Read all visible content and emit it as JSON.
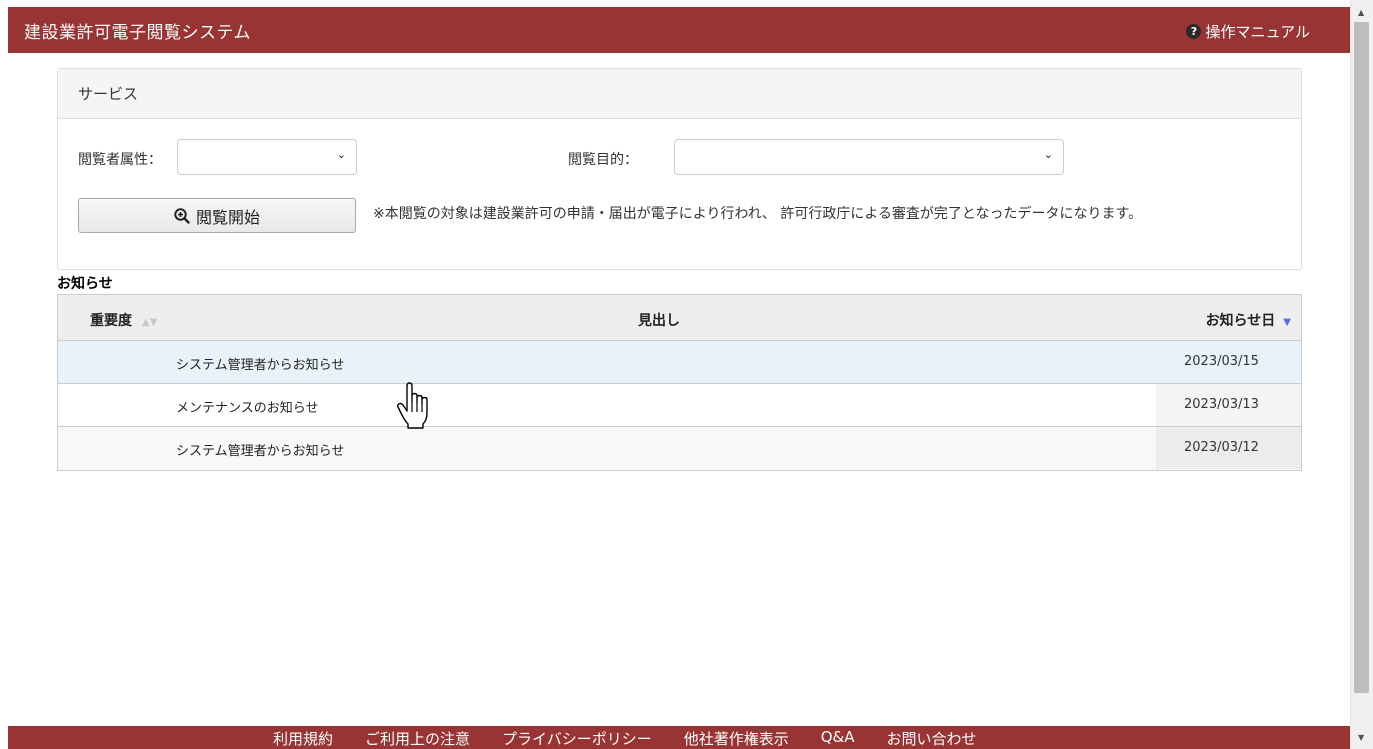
{
  "header": {
    "app_title": "建設業許可電子閲覧システム",
    "manual_label": "操作マニュアル",
    "manual_icon": "help-icon"
  },
  "service": {
    "panel_title": "サービス",
    "viewer_attr_label": "閲覧者属性：",
    "viewer_attr_value": "",
    "purpose_label": "閲覧目的：",
    "purpose_value": "",
    "start_button_label": "閲覧開始",
    "start_button_icon": "zoom-in-icon",
    "note": "※本閲覧の対象は建設業許可の申請・届出が電子により行われ、 許可行政庁による審査が完了となったデータになります。"
  },
  "notices": {
    "section_title": "お知らせ",
    "columns": {
      "importance": "重要度",
      "headline": "見出し",
      "date": "お知らせ日"
    },
    "rows": [
      {
        "importance": "",
        "title": "システム管理者からお知らせ",
        "date": "2023/03/15"
      },
      {
        "importance": "",
        "title": "メンテナンスのお知らせ",
        "date": "2023/03/13"
      },
      {
        "importance": "",
        "title": "システム管理者からお知らせ",
        "date": "2023/03/12"
      }
    ]
  },
  "footer": {
    "links": [
      "利用規約",
      "ご利用上の注意",
      "プライバシーポリシー",
      "他社著作権表示",
      "Q&A",
      "お問い合わせ"
    ]
  },
  "colors": {
    "brand": "#983434",
    "row_hover": "#e8f2f8",
    "sort_active": "#5a6fe0"
  }
}
